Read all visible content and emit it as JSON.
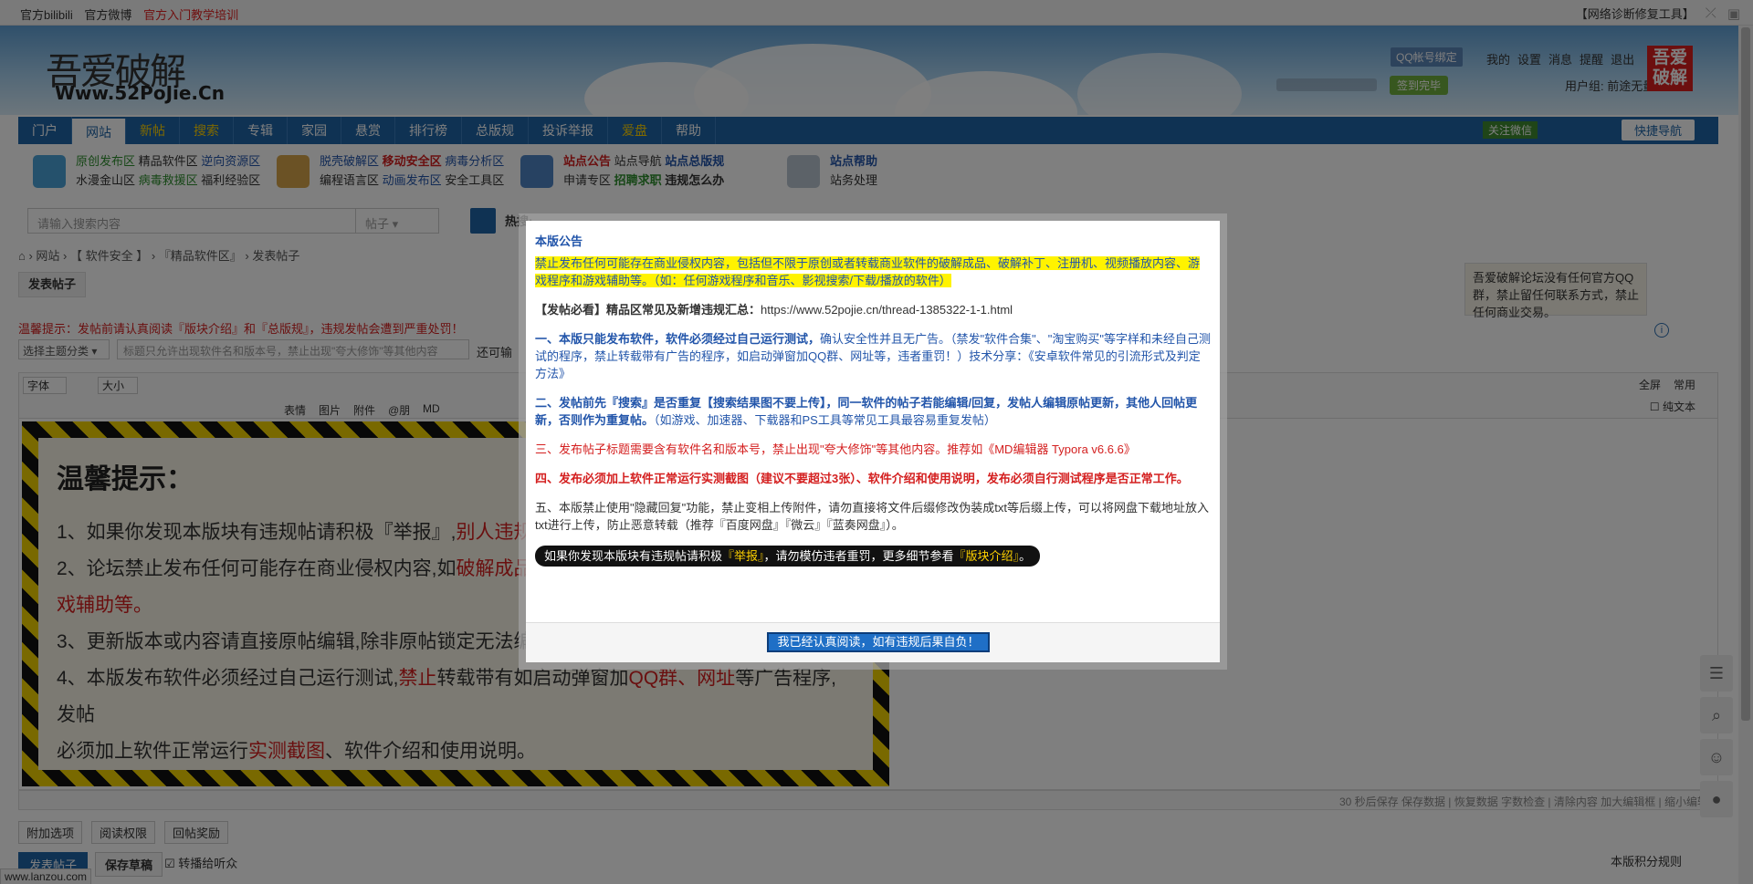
{
  "topbar": {
    "left_links": [
      "官方bilibili",
      "官方微博"
    ],
    "left_highlight": "官方入门教学培训",
    "right_tool": "【网络诊断修复工具】"
  },
  "header": {
    "logo_cn": "吾爱破解",
    "logo_url": "Www.52PoJie.Cn",
    "qq_bind": "QQ帐号绑定",
    "user_links": [
      "我的",
      "设置",
      "消息",
      "提醒",
      "退出"
    ],
    "sign_in": "签到完毕",
    "user_group": "用户组: 前途无量",
    "badge": "吾爱破解"
  },
  "nav": {
    "items": [
      "门户",
      "网站",
      "新帖",
      "搜索",
      "专辑",
      "家园",
      "悬赏",
      "排行榜",
      "总版规",
      "投诉举报",
      "爱盘",
      "帮助"
    ],
    "follow_wechat": "关注微信",
    "quick_nav": "快捷导航"
  },
  "subnav": {
    "g1_row1": [
      "原创发布区",
      "精品软件区",
      "逆向资源区"
    ],
    "g1_row2": [
      "水漫金山区",
      "病毒救援区",
      "福利经验区"
    ],
    "g2_row1": [
      "脱壳破解区",
      "移动安全区",
      "病毒分析区"
    ],
    "g2_row2": [
      "编程语言区",
      "动画发布区",
      "安全工具区"
    ],
    "g3_row1": [
      "站点公告",
      "站点导航",
      "站点总版规"
    ],
    "g3_row2": [
      "申请专区",
      "招聘求职",
      "违规怎么办"
    ],
    "g4_row1": "站点帮助",
    "g4_row2": "站务处理"
  },
  "search": {
    "placeholder": "请输入搜索内容",
    "type": "帖子",
    "hot_label": "热搜:"
  },
  "breadcrumb": [
    "网站",
    "【 软件安全 】",
    "『精品软件区』",
    "发表帖子"
  ],
  "post_tab": "发表帖子",
  "warning": "温馨提示：发帖前请认真阅读『版块介绍』和『总版规』，违规发帖会遭到严重处罚！",
  "form": {
    "type_select": "选择主题分类",
    "title_placeholder": "标题只允许出现软件名和版本号，禁止出现\"夸大修饰\"等其他内容",
    "title_suffix": "还可输"
  },
  "toolbar": {
    "font": "字体",
    "size": "大小",
    "labels": [
      "表情",
      "图片",
      "附件",
      "@朋",
      "MD"
    ],
    "fullscreen": "全屏",
    "common": "常用",
    "plaintext": "纯文本"
  },
  "notice_image": {
    "title": "温馨提示：",
    "lines": [
      "1、如果你发现本版块有违规帖请积极『举报』,",
      "别人违规不",
      "2、论坛禁止发布任何可能存在商业侵权内容,如",
      "破解成品",
      "戏辅助等。",
      "3、更新版本或内容请直接原帖编辑,除非原帖锁定无法编",
      "4、本版发布软件必须经过自己运行测试,",
      "禁止",
      "转载带有如启动弹窗加",
      "QQ群、网址",
      "等广告程序,发帖",
      "必须加上软件正常运行",
      "实测截图",
      "、软件介绍和使用说明。"
    ]
  },
  "statusbar": "30 秒后保存 保存数据 | 恢复数据    字数检查 | 清除内容    加大编辑框 | 缩小编辑",
  "options": [
    "附加选项",
    "阅读权限",
    "回帖奖励"
  ],
  "post_button": "发表帖子",
  "draft_button": "保存草稿",
  "relay_label": "转播给听众",
  "score_rules": "本版积分规则",
  "status_url": "www.lanzou.com",
  "side_tip": "吾爱破解论坛没有任何官方QQ群，禁止留任何联系方式，禁止任何商业交易。",
  "modal": {
    "title": "本版公告",
    "p1": "禁止发布任何可能存在商业侵权内容，包括但不限于原创或者转载商业软件的破解成品、破解补丁、注册机、视频播放内容、游戏程序和游戏辅助等。（如：任何游戏程序和音乐、影视搜索/下载/播放的软件）",
    "p2_bold": "【发帖必看】精品区常见及新增违规汇总：",
    "p2_url": "https://www.52pojie.cn/thread-1385322-1-1.html",
    "p3_bold": "一、本版只能发布软件，软件必须经过自己运行测试，",
    "p3_rest": "确认安全性并且无广告。（禁发\"软件合集\"、\"淘宝购买\"等字样和未经自己测试的程序，禁止转载带有广告的程序，如启动弹窗加QQ群、网址等，违者重罚！）技术分享：《安卓软件常见的引流形式及判定方法》",
    "p4_bold": "二、发帖前先『搜索』是否重复【搜索结果图不要上传】，同一软件的帖子若能编辑/回复，发帖人编辑原帖更新，其他人回帖更新，否则作为重复帖。",
    "p4_rest": "（如游戏、加速器、下载器和PS工具等常见工具最容易重复发帖）",
    "p5": "三、发布帖子标题需要含有软件名和版本号，禁止出现\"夸大修饰\"等其他内容。推荐如《MD编辑器 Typora v6.6.6》",
    "p6": "四、发布必须加上软件正常运行实测截图（建议不要超过3张）、软件介绍和使用说明，发布必须自行测试程序是否正常工作。",
    "p7": "五、本版禁止使用\"隐藏回复\"功能，禁止变相上传附件，请勿直接将文件后缀修改伪装成txt等后缀上传，可以将网盘下载地址放入txt进行上传，防止恶意转载（推荐『百度网盘』『微云』『蓝奏网盘』）。",
    "pill_a": "如果你发现本版块有违规帖请积极",
    "pill_b": "『举报』",
    "pill_c": "，请勿模仿违者重罚，更多细节参看",
    "pill_d": "『版块介绍』",
    "pill_e": "。",
    "confirm": "我已经认真阅读，如有违规后果自负！"
  }
}
